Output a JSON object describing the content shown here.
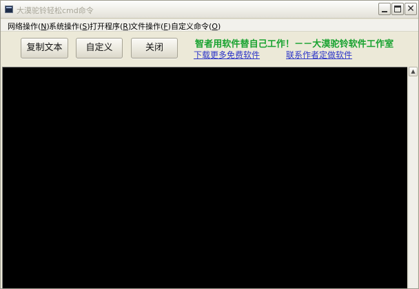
{
  "window": {
    "title": "大漠驼铃轻松cmd命令"
  },
  "menu": [
    {
      "label": "网络操作",
      "key": "N"
    },
    {
      "label": "系统操作",
      "key": "S"
    },
    {
      "label": "打开程序",
      "key": "R"
    },
    {
      "label": "文件操作",
      "key": "F"
    },
    {
      "label": "自定义命令",
      "key": "O"
    }
  ],
  "toolbar": {
    "copy_label": "复制文本",
    "custom_label": "自定义",
    "close_label": "关闭"
  },
  "banner": {
    "slogan": "智者用软件替自己工作！－－大漠驼铃软件工作室",
    "download_link": "下载更多免费软件",
    "contact_link": "联系作者定做软件",
    "slogan_color": "#17a22f",
    "link_color": "#2b34c8"
  },
  "console": {
    "background": "#000000",
    "text": ""
  },
  "icons": {
    "scroll_up": "scroll-up-arrow-icon"
  }
}
